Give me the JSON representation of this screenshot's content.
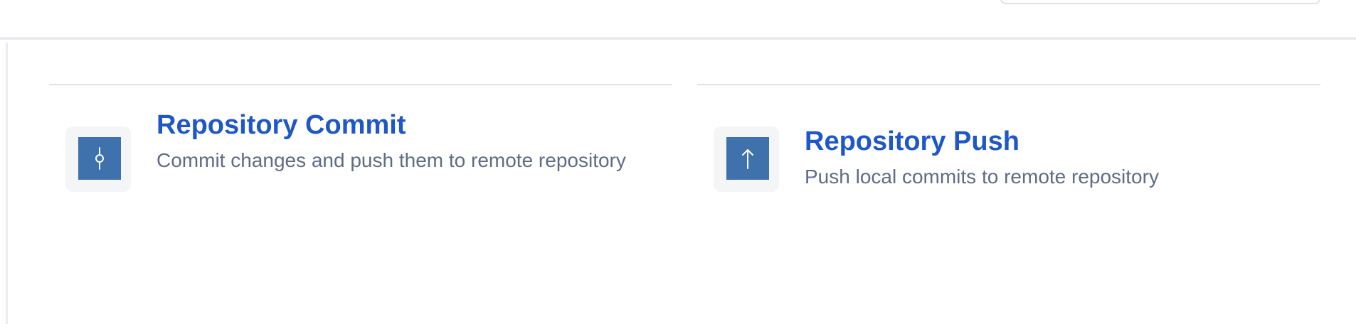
{
  "header": {
    "search_placeholder": ""
  },
  "cards": [
    {
      "title": "Repository Commit",
      "description": "Commit changes and push them to remote repository",
      "icon": "commit-icon"
    },
    {
      "title": "Repository Push",
      "description": "Push local commits to remote repository",
      "icon": "arrow-up-icon"
    }
  ],
  "colors": {
    "link": "#1f57c7",
    "description": "#5e6c84",
    "icon_bg": "#f4f5f7",
    "icon_fill": "#3f72ad",
    "border": "#dfe1e6"
  }
}
